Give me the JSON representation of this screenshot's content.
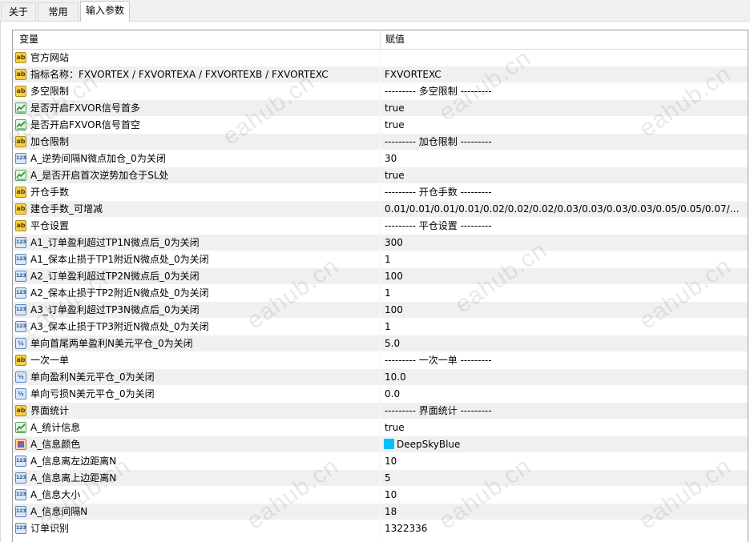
{
  "tabs": [
    "关于",
    "常用",
    "输入参数"
  ],
  "active_tab": 2,
  "columns": {
    "variable": "变量",
    "value": "赋值"
  },
  "watermark": "eahub.cn",
  "colors": {
    "swatch": "#00bfff"
  },
  "rows": [
    {
      "icon": "ab",
      "name": "官方网站",
      "value": ""
    },
    {
      "icon": "ab",
      "name": "指标名称：FXVORTEX / FXVORTEXA / FXVORTEXB / FXVORTEXC",
      "value": "FXVORTEXC"
    },
    {
      "icon": "ab",
      "name": "多空限制",
      "value": "--------- 多空限制 ---------"
    },
    {
      "icon": "bool",
      "name": "是否开启FXVOR信号首多",
      "value": "true"
    },
    {
      "icon": "bool",
      "name": "是否开启FXVOR信号首空",
      "value": "true"
    },
    {
      "icon": "ab",
      "name": "加仓限制",
      "value": "--------- 加仓限制 ---------"
    },
    {
      "icon": "int",
      "name": "A_逆势间隔N微点加仓_0为关闭",
      "value": "30"
    },
    {
      "icon": "bool",
      "name": "A_是否开启首次逆势加仓于SL处",
      "value": "true"
    },
    {
      "icon": "ab",
      "name": "开仓手数",
      "value": "--------- 开仓手数 ---------"
    },
    {
      "icon": "ab",
      "name": "建仓手数_可增减",
      "value": "0.01/0.01/0.01/0.01/0.02/0.02/0.02/0.03/0.03/0.03/0.03/0.05/0.05/0.07/0.07/..."
    },
    {
      "icon": "ab",
      "name": "平仓设置",
      "value": "--------- 平仓设置 ---------"
    },
    {
      "icon": "int",
      "name": "A1_订单盈利超过TP1N微点后_0为关闭",
      "value": "300"
    },
    {
      "icon": "int",
      "name": "A1_保本止损于TP1附近N微点处_0为关闭",
      "value": "1"
    },
    {
      "icon": "int",
      "name": "A2_订单盈利超过TP2N微点后_0为关闭",
      "value": "100"
    },
    {
      "icon": "int",
      "name": "A2_保本止损于TP2附近N微点处_0为关闭",
      "value": "1"
    },
    {
      "icon": "int",
      "name": "A3_订单盈利超过TP3N微点后_0为关闭",
      "value": "100"
    },
    {
      "icon": "int",
      "name": "A3_保本止损于TP3附近N微点处_0为关闭",
      "value": "1"
    },
    {
      "icon": "dbl",
      "name": "单向首尾两单盈利N美元平仓_0为关闭",
      "value": "5.0"
    },
    {
      "icon": "ab",
      "name": "一次一单",
      "value": "--------- 一次一单 ---------"
    },
    {
      "icon": "dbl",
      "name": "单向盈利N美元平仓_0为关闭",
      "value": "10.0"
    },
    {
      "icon": "dbl",
      "name": "单向亏损N美元平仓_0为关闭",
      "value": "0.0"
    },
    {
      "icon": "ab",
      "name": "界面统计",
      "value": "--------- 界面统计 ---------"
    },
    {
      "icon": "bool",
      "name": "A_统计信息",
      "value": "true"
    },
    {
      "icon": "color",
      "name": "A_信息颜色",
      "value": "DeepSkyBlue"
    },
    {
      "icon": "int",
      "name": "A_信息离左边距离N",
      "value": "10"
    },
    {
      "icon": "int",
      "name": "A_信息离上边距离N",
      "value": "5"
    },
    {
      "icon": "int",
      "name": "A_信息大小",
      "value": "10"
    },
    {
      "icon": "int",
      "name": "A_信息间隔N",
      "value": "18"
    },
    {
      "icon": "int",
      "name": "订单识别",
      "value": "1322336"
    }
  ]
}
